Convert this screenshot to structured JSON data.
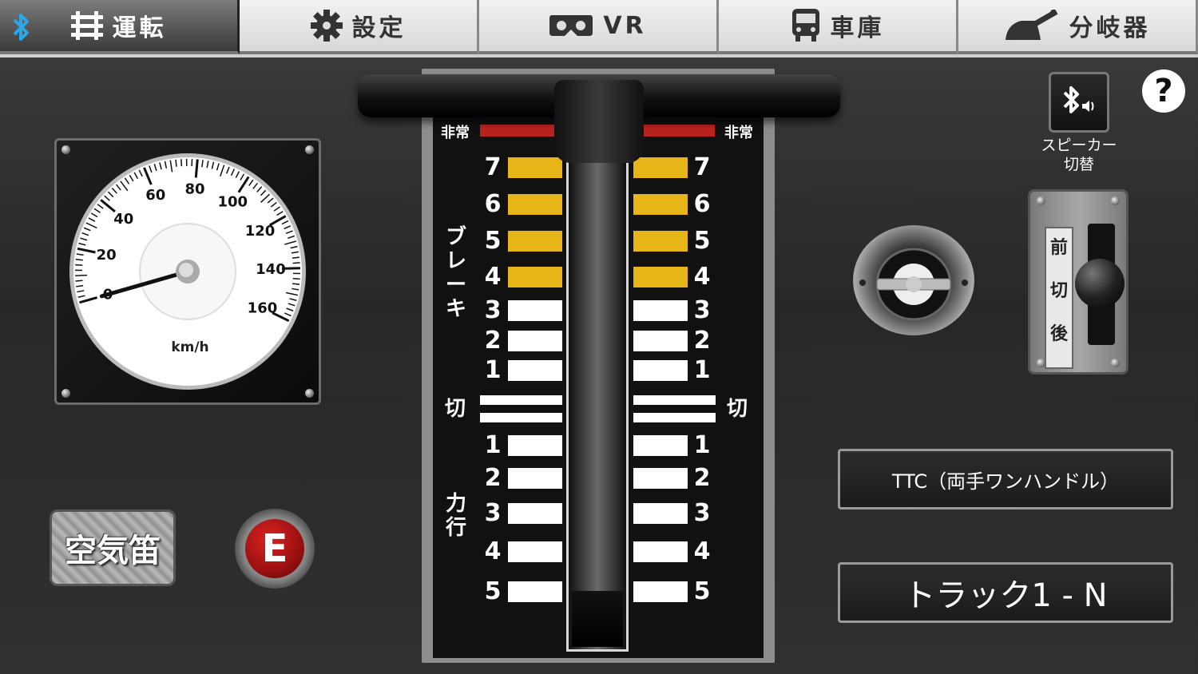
{
  "tabs": [
    {
      "label": "運転",
      "icon": "track-icon",
      "active": true
    },
    {
      "label": "設定",
      "icon": "gear-icon",
      "active": false
    },
    {
      "label": "VR",
      "icon": "vr-headset-icon",
      "active": false
    },
    {
      "label": "車庫",
      "icon": "train-icon",
      "active": false
    },
    {
      "label": "分岐器",
      "icon": "railway-switch-icon",
      "active": false
    }
  ],
  "speedometer": {
    "unit": "km/h",
    "ticks": [
      "0",
      "20",
      "40",
      "60",
      "80",
      "100",
      "120",
      "140",
      "160"
    ],
    "max": 160,
    "value": 0
  },
  "controller": {
    "emergency_label": "非常",
    "brake_label": "ブレーキ",
    "off_label": "切",
    "power_label": "力行",
    "brake_notches": [
      "7",
      "6",
      "5",
      "4",
      "3",
      "2",
      "1"
    ],
    "power_notches": [
      "1",
      "2",
      "3",
      "4",
      "5"
    ],
    "current_position": "切"
  },
  "buttons": {
    "horn_label": "空気笛",
    "emergency_label": "E",
    "help_label": "?",
    "speaker_label_line1": "スピーカー",
    "speaker_label_line2": "切替",
    "handle_type_label": "TTC（両手ワンハンドル）",
    "track_label": "トラック1 - N"
  },
  "reverser": {
    "labels": [
      "前",
      "切",
      "後"
    ],
    "position": "切"
  },
  "colors": {
    "brake_high": "#e8b518",
    "emergency": "#b8231f",
    "accent_bluetooth": "#2aa8e8"
  }
}
